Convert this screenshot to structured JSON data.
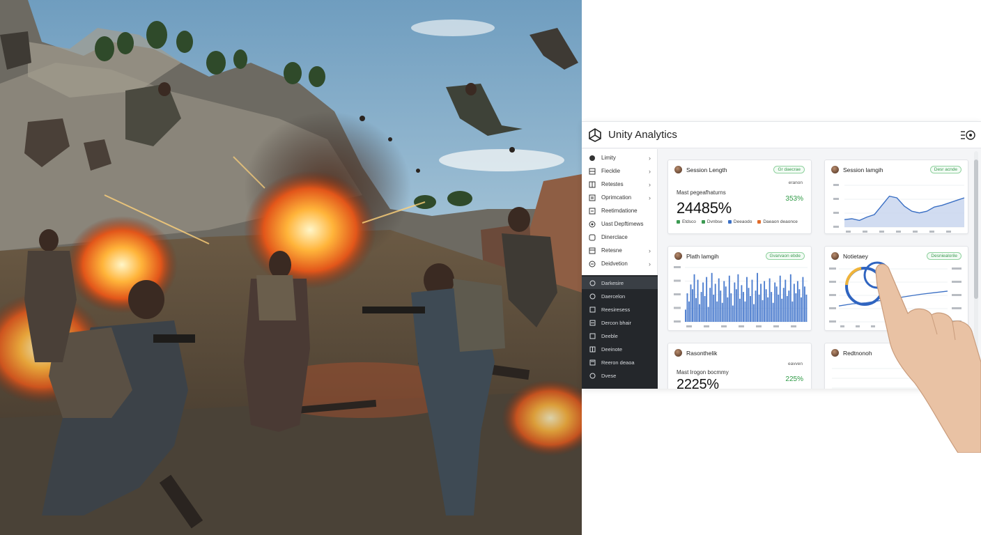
{
  "app": {
    "title": "Unity Analytics",
    "logo_icon": "unity-logo-icon",
    "menu_icon": "menu-settings-icon"
  },
  "sidebar": {
    "items": [
      {
        "label": "Limity",
        "icon": "circle-icon",
        "chevron": "›"
      },
      {
        "label": "Fiecklie",
        "icon": "grid-icon",
        "chevron": "›"
      },
      {
        "label": "Retestes",
        "icon": "grid-icon",
        "chevron": "›"
      },
      {
        "label": "Oprimcation",
        "icon": "list-icon",
        "chevron": "›"
      },
      {
        "label": "Reetimdatione",
        "icon": "list-icon",
        "chevron": ""
      },
      {
        "label": "Uast Depftimews",
        "icon": "target-icon",
        "chevron": ""
      },
      {
        "label": "Dinerclace",
        "icon": "list-icon",
        "chevron": ""
      },
      {
        "label": "Retesne",
        "icon": "list-icon",
        "chevron": "›"
      },
      {
        "label": "Deidvetion",
        "icon": "circle-icon",
        "chevron": "›"
      }
    ],
    "dark_items": [
      {
        "label": "Darkesire",
        "icon": "circle-icon"
      },
      {
        "label": "Daercelon",
        "icon": "circle-icon"
      },
      {
        "label": "Reesiresess",
        "icon": "grid-icon"
      },
      {
        "label": "Dercon bhair",
        "icon": "list-icon"
      },
      {
        "label": "Deeble",
        "icon": "list-icon"
      },
      {
        "label": "Deeinote",
        "icon": "grid-icon"
      },
      {
        "label": "Reeron deaoa",
        "icon": "list-icon"
      },
      {
        "label": "Dvese",
        "icon": "circle-icon"
      }
    ]
  },
  "cards": {
    "session_length": {
      "title": "Session Length",
      "badge": "Gr daecrae",
      "note": "eranon",
      "subtitle": "Mast pegeafhaturns",
      "big_value": "24485%",
      "pct": "353%",
      "legend": [
        {
          "label": "Etdsco",
          "color": "#3c9a52"
        },
        {
          "label": "Dvnbse",
          "color": "#3c9a52"
        },
        {
          "label": "Deeaodo",
          "color": "#3a6fc4"
        },
        {
          "label": "Daeaon deaonce",
          "color": "#e06b2a"
        }
      ]
    },
    "session_lamgih": {
      "title": "Session lamgih",
      "badge": "Desr acnde"
    },
    "plath_lamgih": {
      "title": "Plath lamgih",
      "badge": "Gvarvaon ebde"
    },
    "notietaey": {
      "title": "Notietaey",
      "badge": "Desniealorile"
    },
    "rasonthelik": {
      "title": "Rasonthelik",
      "note": "eavven",
      "subtitle": "Mast Irogon bocmmy",
      "big_value": "2225%",
      "pct": "225%"
    },
    "redtnonoh": {
      "title": "Redtnonoh"
    }
  },
  "chart_data": [
    {
      "type": "area",
      "title": "Session lamgih",
      "x": [
        0,
        1,
        2,
        3,
        4,
        5,
        6,
        7,
        8,
        9,
        10,
        11,
        12,
        13,
        14,
        15,
        16
      ],
      "values": [
        18,
        20,
        16,
        24,
        30,
        52,
        74,
        70,
        50,
        38,
        34,
        38,
        48,
        52,
        58,
        64,
        70
      ],
      "ylim": [
        0,
        100
      ]
    },
    {
      "type": "bar",
      "title": "Plath lamgih",
      "values": [
        18,
        42,
        30,
        55,
        48,
        70,
        35,
        62,
        26,
        44,
        58,
        38,
        66,
        22,
        50,
        72,
        40,
        56,
        30,
        64,
        46,
        28,
        60,
        52,
        36,
        68,
        42,
        24,
        58,
        48,
        70,
        34,
        54,
        44,
        30,
        66,
        50,
        38,
        62,
        26,
        46,
        72,
        40,
        56,
        32,
        60,
        48,
        36,
        64,
        44,
        28,
        58,
        52,
        40,
        68,
        34,
        50,
        62,
        38,
        46,
        70,
        30,
        56,
        42,
        60,
        48,
        36,
        66,
        52,
        40
      ],
      "ylim": [
        0,
        80
      ]
    },
    {
      "type": "line",
      "title": "Notietaey",
      "x": [
        0,
        1,
        2,
        3,
        4,
        5,
        6,
        7,
        8
      ],
      "series": [
        {
          "values": [
            30,
            34,
            36,
            40,
            44,
            48,
            52,
            55,
            58
          ]
        }
      ],
      "ylim": [
        0,
        100
      ]
    }
  ],
  "colors": {
    "accent_blue": "#3a6fc4",
    "accent_green": "#3c9a52",
    "sidebar_dark": "#24272b"
  }
}
